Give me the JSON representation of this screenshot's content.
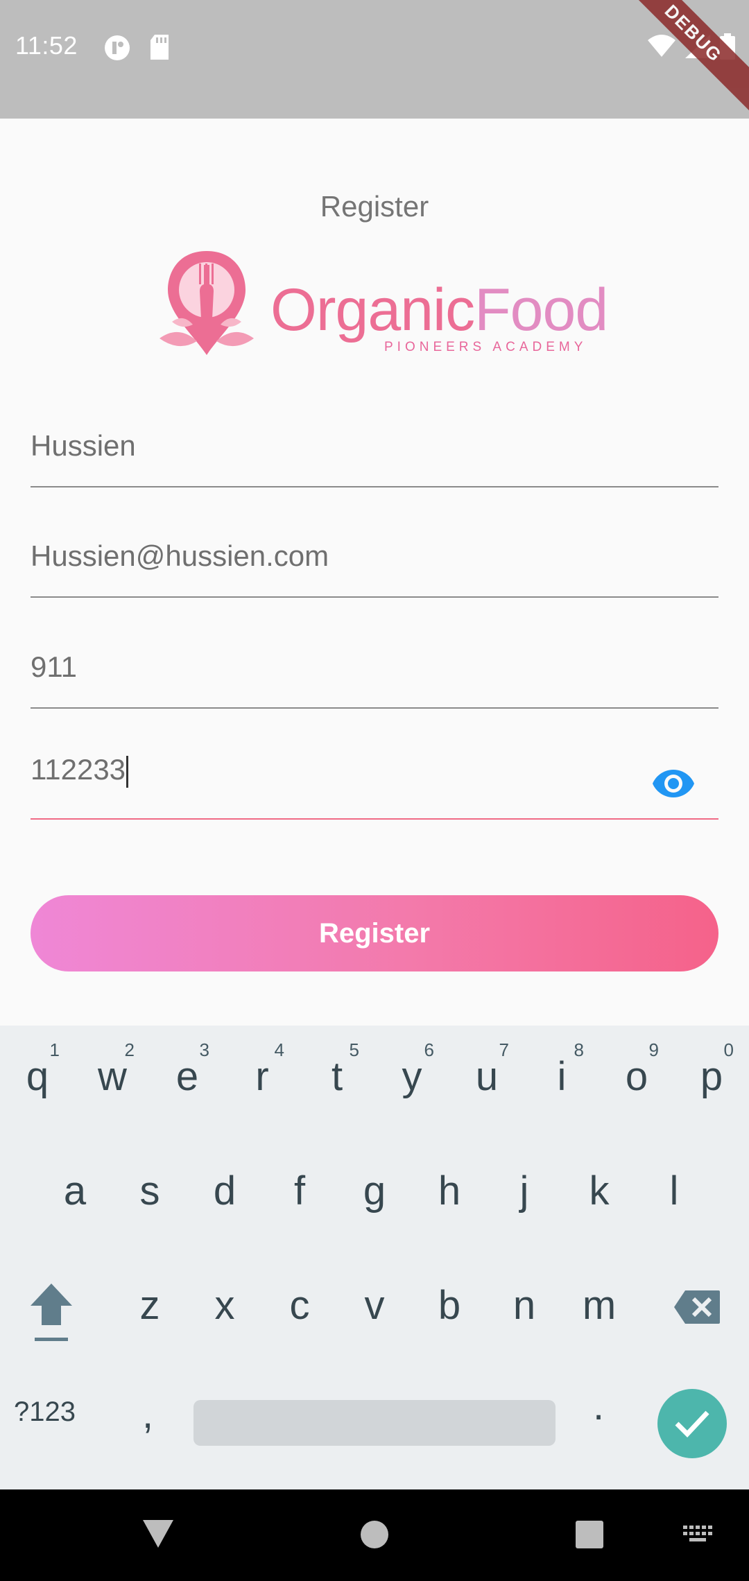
{
  "status_bar": {
    "time": "11:52",
    "icons_left": [
      "app-notification-icon",
      "sd-card-icon"
    ],
    "icons_right": [
      "wifi-icon",
      "cell-signal-icon",
      "battery-icon"
    ],
    "debug_banner": "DEBUG",
    "background": "#bdbdbd"
  },
  "page": {
    "title": "Register"
  },
  "logo": {
    "brand_first": "Organic",
    "brand_second": "Food",
    "tagline": "PIONEERS ACADEMY",
    "icon": "fork-location-pin-icon"
  },
  "form": {
    "name_value": "Hussien",
    "email_value": "Hussien@hussien.com",
    "phone_value": "911",
    "password_value": "112233",
    "password_toggle_icon": "eye-icon",
    "register_label": "Register",
    "accent_color": "#f06a85",
    "eye_color": "#2196f3"
  },
  "keyboard": {
    "row1": [
      {
        "c": "q",
        "h": "1"
      },
      {
        "c": "w",
        "h": "2"
      },
      {
        "c": "e",
        "h": "3"
      },
      {
        "c": "r",
        "h": "4"
      },
      {
        "c": "t",
        "h": "5"
      },
      {
        "c": "y",
        "h": "6"
      },
      {
        "c": "u",
        "h": "7"
      },
      {
        "c": "i",
        "h": "8"
      },
      {
        "c": "o",
        "h": "9"
      },
      {
        "c": "p",
        "h": "0"
      }
    ],
    "row2": [
      "a",
      "s",
      "d",
      "f",
      "g",
      "h",
      "j",
      "k",
      "l"
    ],
    "row3": [
      "z",
      "x",
      "c",
      "v",
      "b",
      "n",
      "m"
    ],
    "symbols_label": "?123",
    "comma": ",",
    "period": ".",
    "shift_icon": "shift-icon",
    "backspace_icon": "backspace-icon",
    "done_icon": "check-icon"
  },
  "nav_bar": {
    "icons": [
      "back-triangle-icon",
      "home-circle-icon",
      "recents-square-icon",
      "keyboard-switch-icon"
    ]
  }
}
